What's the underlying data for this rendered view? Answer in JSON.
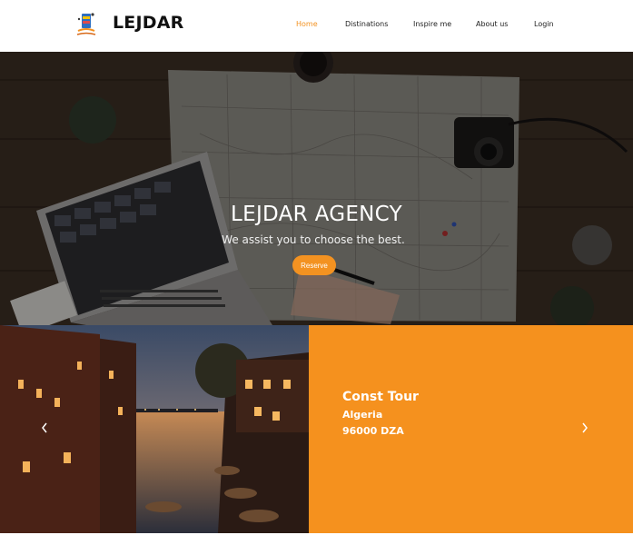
{
  "header": {
    "brand": "LEJDAR",
    "nav": [
      {
        "label": "Home",
        "active": true
      },
      {
        "label": "Distinations",
        "active": false
      },
      {
        "label": "Inspire me",
        "active": false
      },
      {
        "label": "About us",
        "active": false
      },
      {
        "label": "Login",
        "active": false
      }
    ]
  },
  "hero": {
    "title": "LEJDAR AGENCY",
    "subtitle": "We assist you to choose the best.",
    "reserve_label": "Reserve"
  },
  "slider": {
    "title": "Const Tour",
    "country": "Algeria",
    "price": "96000 DZA",
    "prev_icon": "chevron-left-icon",
    "next_icon": "chevron-right-icon"
  },
  "colors": {
    "accent": "#f39221",
    "panel": "#f5911e",
    "text_dark": "#111111"
  }
}
